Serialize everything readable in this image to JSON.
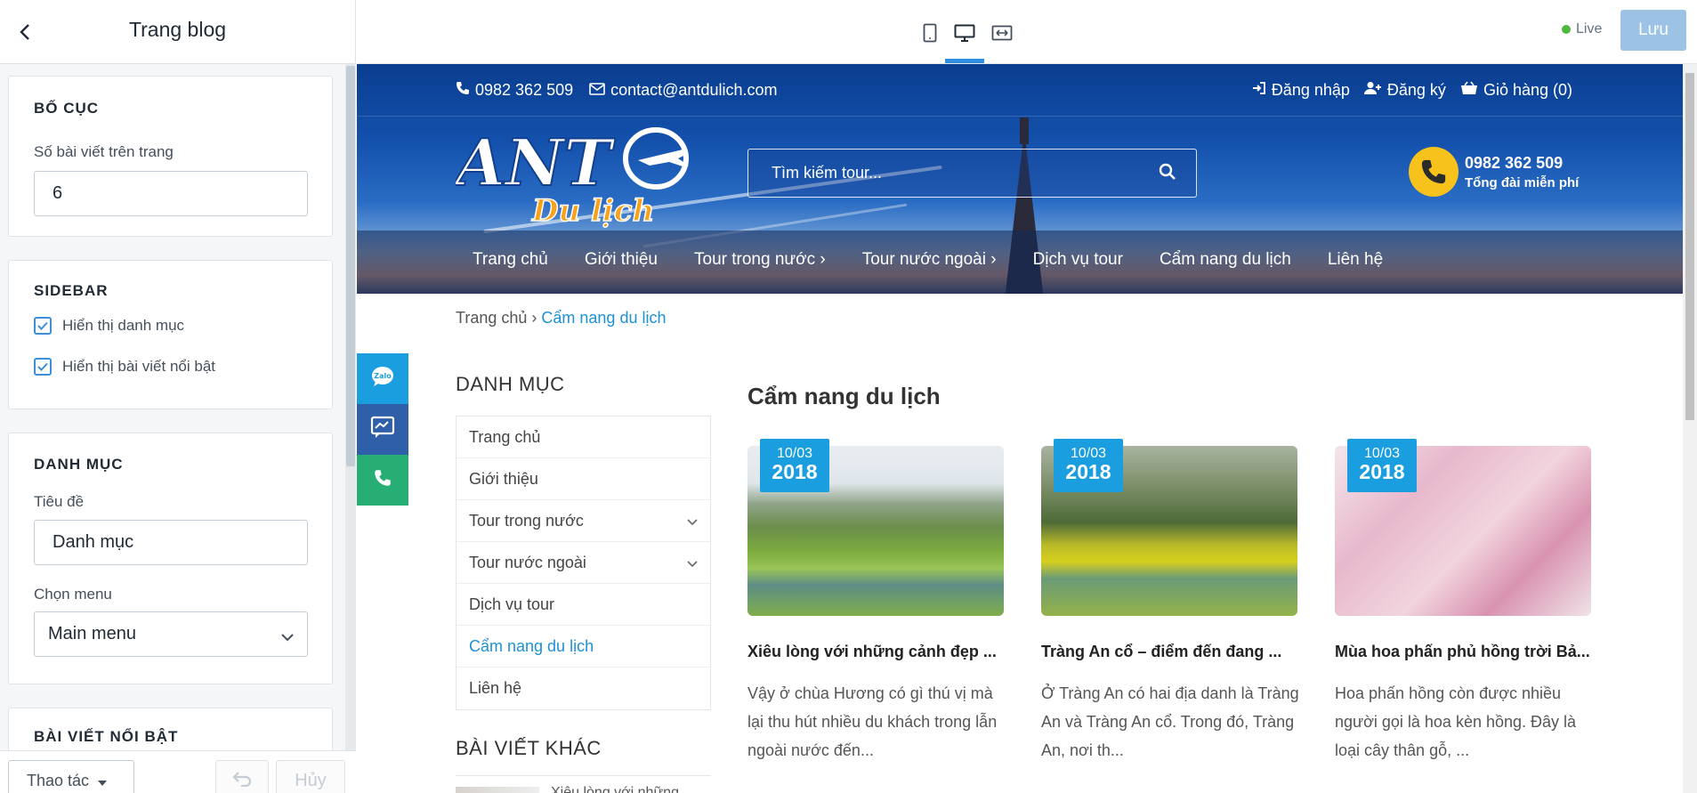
{
  "editor": {
    "title": "Trang blog",
    "sections": {
      "layout": {
        "title": "BỐ CỤC",
        "posts_label": "Số bài viết trên trang",
        "posts_value": "6"
      },
      "sidebar": {
        "title": "SIDEBAR",
        "show_categories": "Hiển thị danh mục",
        "show_featured": "Hiển thị bài viết nổi bật"
      },
      "category": {
        "title": "DANH MỤC",
        "heading_label": "Tiêu đề",
        "heading_value": "Danh mục",
        "menu_label": "Chọn menu",
        "menu_value": "Main menu"
      },
      "featured": {
        "title": "BÀI VIẾT NỔI BẬT"
      }
    },
    "footer": {
      "actions": "Thao tác",
      "cancel": "Hủy"
    }
  },
  "toolbar": {
    "live": "Live",
    "save": "Lưu"
  },
  "site": {
    "topbar": {
      "phone": "0982 362 509",
      "email": "contact@antdulich.com",
      "login": "Đăng nhập",
      "register": "Đăng ký",
      "cart": "Giỏ hàng (0)"
    },
    "logo": {
      "main": "ANT",
      "sub": "Du lịch"
    },
    "search_placeholder": "Tìm kiếm tour...",
    "hotline": {
      "number": "0982 362 509",
      "label": "Tổng đài miễn phí"
    },
    "nav": [
      "Trang chủ",
      "Giới thiệu",
      "Tour trong nước ›",
      "Tour nước ngoài ›",
      "Dịch vụ tour",
      "Cẩm nang du lịch",
      "Liên hệ"
    ],
    "breadcrumb": {
      "home": "Trang chủ",
      "sep": " › ",
      "current": "Cẩm nang du lịch"
    },
    "sidebar": {
      "categories_title": "DANH MỤC",
      "categories": [
        "Trang chủ",
        "Giới thiệu",
        "Tour trong nước",
        "Tour nước ngoài",
        "Dịch vụ tour",
        "Cẩm nang du lịch",
        "Liên hệ"
      ],
      "other_title": "BÀI VIẾT KHÁC",
      "other_first": "Xiêu lòng với những"
    },
    "main_title": "Cẩm nang du lịch",
    "posts": [
      {
        "day": "10/03",
        "year": "2018",
        "title": "Xiêu lòng với những cảnh đẹp ...",
        "excerpt": "Vậy ở chùa Hương có gì thú vị mà lại thu hút nhiều du khách trong lẫn ngoài nước đến..."
      },
      {
        "day": "10/03",
        "year": "2018",
        "title": "Tràng An cổ – điểm đến đang ...",
        "excerpt": "Ở Tràng An có hai địa danh là Tràng An và Tràng An cổ. Trong đó, Tràng An, nơi th..."
      },
      {
        "day": "10/03",
        "year": "2018",
        "title": "Mùa hoa phấn phủ hồng trời Bả...",
        "excerpt": "Hoa phấn hồng còn được nhiều người gọi là hoa kèn hồng. Đây là loại cây thân gỗ, ..."
      }
    ]
  },
  "colors": {
    "accent": "#1e90d6",
    "save_btn": "#9cc3e5",
    "badge": "#1a9ee0",
    "live_dot": "#50b83c"
  }
}
